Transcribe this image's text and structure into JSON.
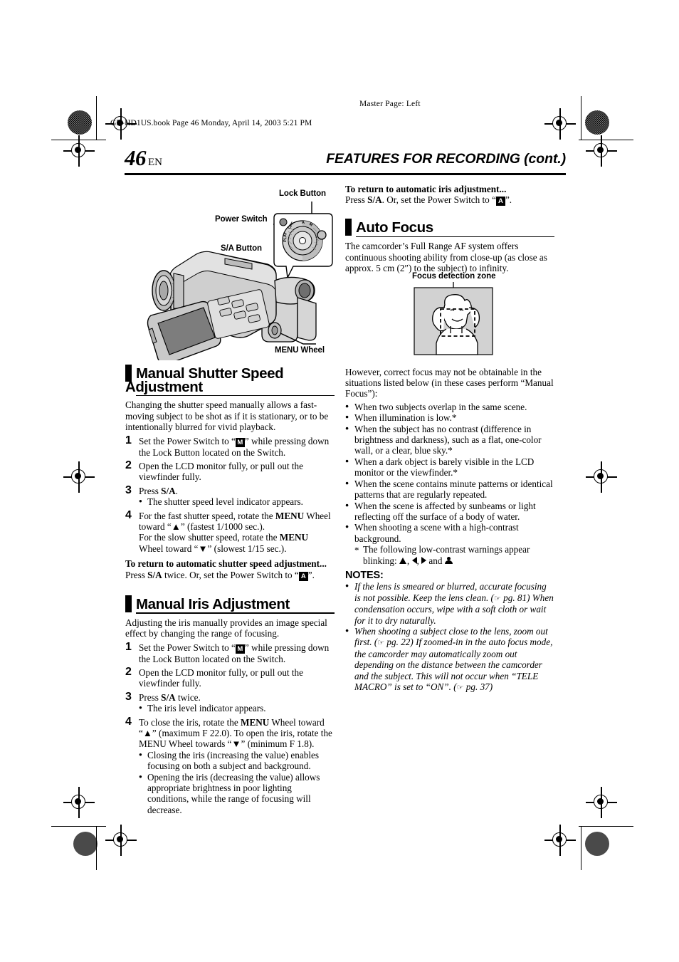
{
  "print_marks": {
    "master_page": "Master Page: Left",
    "book_line": "GR-HD1US.book  Page 46  Monday, April 14, 2003  5:21 PM"
  },
  "header": {
    "folio_number": "46",
    "folio_suffix": "EN",
    "running_head": "FEATURES FOR RECORDING (cont.)"
  },
  "figures": {
    "camcorder": {
      "callouts": {
        "lock_button": "Lock Button",
        "power_switch": "Power Switch",
        "sa_button": "S/A Button",
        "menu_wheel": "MENU Wheel"
      },
      "dial_labels": [
        "A",
        "M",
        "PLAY",
        "OFF"
      ]
    },
    "focus_zone": {
      "caption": "Focus detection zone"
    }
  },
  "left_column": {
    "shutter_section": {
      "heading": "Manual Shutter Speed Adjustment",
      "intro": "Changing the shutter speed manually allows a fast-moving subject to be shot as if it is stationary, or to be intentionally blurred for vivid playback.",
      "steps": [
        {
          "num": "1",
          "pre": "Set the Power Switch to “",
          "glyph": "M",
          "post": "” while pressing down the Lock Button located on the Switch."
        },
        {
          "num": "2",
          "text": "Open the LCD monitor fully, or pull out the viewfinder fully."
        },
        {
          "num": "3",
          "text_pre": "Press ",
          "text_bold": "S/A",
          "text_post": ".",
          "sub": "The shutter speed level indicator appears."
        },
        {
          "num": "4",
          "line1_pre": "For the fast shutter speed, rotate the ",
          "line1_bold": "MENU",
          "line1_post": " Wheel toward “▲” (fastest 1/1000 sec.).",
          "line2_pre": "For the slow shutter speed, rotate the ",
          "line2_bold": "MENU",
          "line2_post": " Wheel toward “▼” (slowest 1/15 sec.)."
        }
      ],
      "return_heading": "To return to automatic shutter speed adjustment...",
      "return_pre": "Press ",
      "return_bold": "S/A",
      "return_mid": " twice. Or, set the Power Switch to “",
      "return_glyph": "A",
      "return_post": "”."
    },
    "iris_section": {
      "heading": "Manual Iris Adjustment",
      "intro": "Adjusting the iris manually provides an image special effect by changing the range of focusing.",
      "steps": [
        {
          "num": "1",
          "pre": "Set the Power Switch to “",
          "glyph": "M",
          "post": "” while pressing down the Lock Button located on the Switch."
        },
        {
          "num": "2",
          "text": "Open the LCD monitor fully, or pull out the viewfinder fully."
        },
        {
          "num": "3",
          "text_pre": "Press ",
          "text_bold": "S/A",
          "text_post": " twice.",
          "sub": "The iris level indicator appears."
        },
        {
          "num": "4",
          "line1_pre": "To close the iris, rotate the ",
          "line1_bold": "MENU",
          "line1_post": " Wheel toward “▲” (maximum F 22.0). To open the iris, rotate the MENU Wheel towards “▼” (minimum F 1.8).",
          "subs": [
            "Closing the iris (increasing the value) enables focusing on both a subject and background.",
            "Opening the iris (decreasing the value) allows appropriate brightness in poor lighting conditions, while the range of focusing will decrease."
          ]
        }
      ]
    }
  },
  "right_column": {
    "iris_return": {
      "heading": "To return to automatic iris adjustment...",
      "pre": "Press ",
      "bold": "S/A",
      "mid": ". Or, set the Power Switch to “",
      "glyph": "A",
      "post": "”."
    },
    "autofocus_section": {
      "heading": "Auto Focus",
      "intro": "The camcorder’s Full Range AF system offers continuous shooting ability from close-up (as close as approx. 5 cm (2″) to the subject) to infinity.",
      "however": "However, correct focus may not be obtainable in the situations listed below (in these cases perform “Manual Focus”):",
      "bullets": [
        "When two subjects overlap in the same scene.",
        "When illumination is low.*",
        "When the subject has no contrast (difference in brightness and darkness), such as a flat, one-color wall, or a clear, blue sky.*",
        "When a dark object is barely visible in the LCD monitor or the viewfinder.*",
        "When the scene contains minute patterns or identical patterns that are regularly repeated.",
        "When the scene is affected by sunbeams or light reflecting off the surface of a body of water.",
        "When shooting a scene with a high-contrast background."
      ],
      "star_note_pre": "The following low-contrast warnings appear blinking: ",
      "star_note_sep1": ", ",
      "star_note_sep2": ", ",
      "star_note_and": " and "
    },
    "notes": {
      "heading": "NOTES:",
      "items": [
        {
          "text_a": "If the lens is smeared or blurred, accurate focusing is not possible. Keep the lens clean. (",
          "ref": "pg. 81",
          "text_b": ") When condensation occurs, wipe with a soft cloth or wait for it to dry naturally."
        },
        {
          "text_a": "When shooting a subject close to the lens, zoom out first. (",
          "ref": "pg. 22",
          "text_b": ") If zoomed-in in the auto focus mode, the camcorder may automatically zoom out depending on the distance between the camcorder and the subject. This will not occur when “TELE MACRO” is set to “ON”. (",
          "ref2": "pg. 37",
          "text_c": ")"
        }
      ]
    }
  }
}
